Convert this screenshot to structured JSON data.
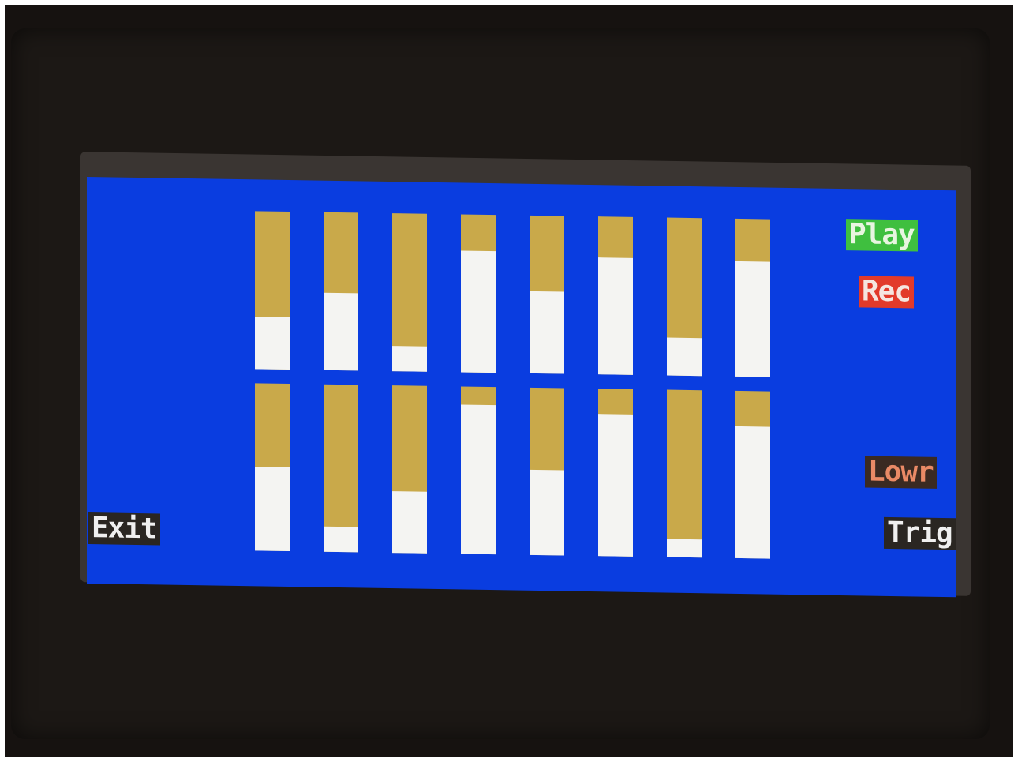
{
  "screen": {
    "background_color": "#0a3de0",
    "slider_track_color": "#c9a94a",
    "slider_fill_color": "#f4f4f2"
  },
  "sliders": {
    "top_row": [
      0.33,
      0.49,
      0.16,
      0.77,
      0.52,
      0.74,
      0.24,
      0.73
    ],
    "bottom_row": [
      0.5,
      0.15,
      0.37,
      0.89,
      0.51,
      0.85,
      0.11,
      0.79
    ]
  },
  "buttons": {
    "play": "Play",
    "rec": "Rec",
    "lowr": "Lowr",
    "trig": "Trig",
    "exit": "Exit"
  }
}
